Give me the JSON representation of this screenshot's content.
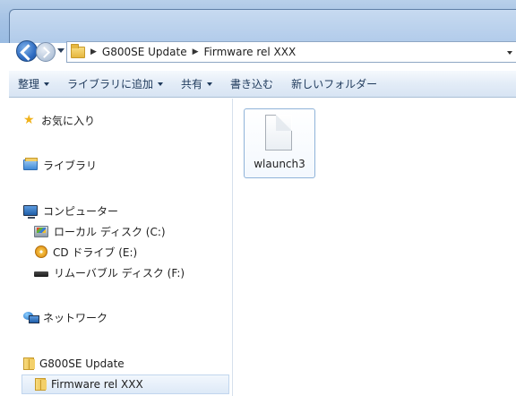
{
  "address": {
    "crumbs": [
      "G800SE Update",
      "Firmware rel XXX"
    ]
  },
  "command_bar": {
    "organize": "整理",
    "include_in_library": "ライブラリに追加",
    "share": "共有",
    "burn": "書き込む",
    "new_folder": "新しいフォルダー"
  },
  "nav": {
    "favorites": "お気に入り",
    "libraries": "ライブラリ",
    "computer": "コンピューター",
    "local_disk": "ローカル ディスク (C:)",
    "cd_drive": "CD ドライブ (E:)",
    "removable_disk": "リムーバブル ディスク (F:)",
    "network": "ネットワーク",
    "folder_parent": "G800SE Update",
    "folder_current": "Firmware rel XXX"
  },
  "content": {
    "files": [
      {
        "name": "wlaunch3",
        "icon": "document-icon"
      }
    ]
  }
}
